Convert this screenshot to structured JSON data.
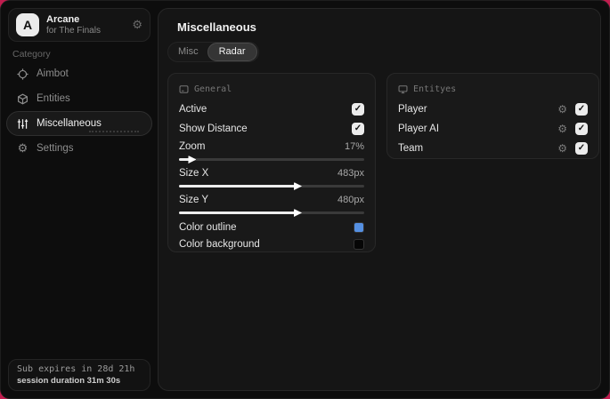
{
  "app": {
    "name": "Arcane",
    "subtitle": "for The Finals",
    "avatar_letter": "A"
  },
  "sidebar": {
    "category_label": "Category",
    "items": [
      {
        "label": "Aimbot",
        "icon": "crosshair-icon",
        "selected": false
      },
      {
        "label": "Entities",
        "icon": "cube-icon",
        "selected": false
      },
      {
        "label": "Miscellaneous",
        "icon": "sliders-icon",
        "selected": true
      },
      {
        "label": "Settings",
        "icon": "gear-icon",
        "selected": false
      }
    ],
    "footer": {
      "line1": "Sub expires in 28d 21h",
      "line2": "session duration 31m 30s"
    }
  },
  "main": {
    "title": "Miscellaneous",
    "tabs": [
      {
        "label": "Misc",
        "selected": false
      },
      {
        "label": "Radar",
        "selected": true
      }
    ],
    "general": {
      "title": "General",
      "toggles": [
        {
          "label": "Active",
          "checked": true
        },
        {
          "label": "Show Distance",
          "checked": true
        }
      ],
      "sliders": [
        {
          "label": "Zoom",
          "value": "17%",
          "percent": 6
        },
        {
          "label": "Size X",
          "value": "483px",
          "percent": 63
        },
        {
          "label": "Size Y",
          "value": "480px",
          "percent": 63
        }
      ],
      "color_rows": [
        {
          "label": "Color outline",
          "swatch": "#5590e2"
        },
        {
          "label": "Color background",
          "swatch": "#060606"
        }
      ]
    },
    "entities": {
      "title": "Entityes",
      "items": [
        {
          "label": "Player",
          "checked": true
        },
        {
          "label": "Player AI",
          "checked": true
        },
        {
          "label": "Team",
          "checked": true
        }
      ]
    }
  },
  "icons": {
    "gear": "⚙",
    "check": "✓"
  },
  "colors": {
    "backdrop": "#c01d4e",
    "outline_swatch": "#5590e2",
    "background_swatch": "#060606"
  }
}
